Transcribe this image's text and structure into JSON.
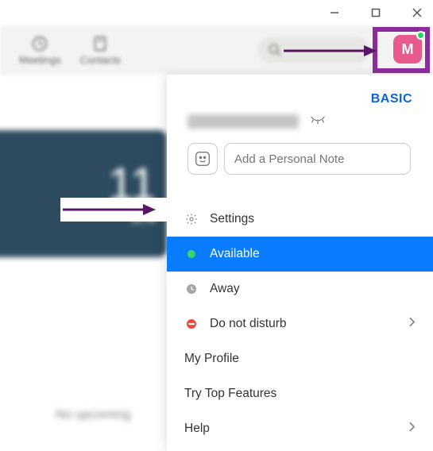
{
  "window": {
    "minimize": "minimize",
    "maximize": "maximize",
    "close": "close"
  },
  "toolbar": {
    "meetings": "Meetings",
    "contacts": "Contacts"
  },
  "avatar": {
    "letter": "M"
  },
  "bg": {
    "time": "11",
    "date": "28 M",
    "no_upcoming": "No upcoming"
  },
  "dropdown": {
    "badge": "BASIC",
    "note_placeholder": "Add a Personal Note",
    "settings": "Settings",
    "available": "Available",
    "away": "Away",
    "dnd": "Do not disturb",
    "my_profile": "My Profile",
    "try_top": "Try Top Features",
    "help": "Help"
  }
}
